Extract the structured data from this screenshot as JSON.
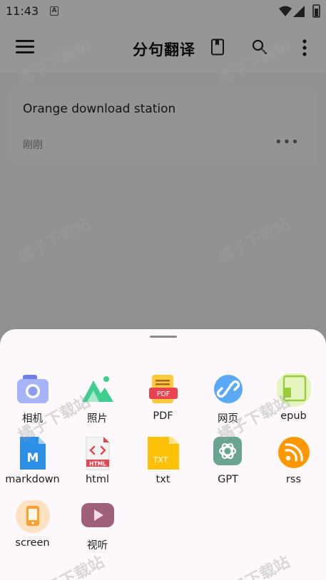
{
  "status_bar": {
    "time": "11:43",
    "notification_letter": "A"
  },
  "app_bar": {
    "title": "分句翻译",
    "icons": [
      "menu-icon",
      "book-icon",
      "search-icon",
      "more-vert-icon"
    ]
  },
  "documents": [
    {
      "title": "Orange download station",
      "time": "刚刚"
    }
  ],
  "import_sheet": {
    "items": [
      {
        "label": "相机",
        "icon": "camera-icon",
        "color": "#8c9cf2"
      },
      {
        "label": "照片",
        "icon": "photo-icon",
        "color": "#3ecf8e"
      },
      {
        "label": "PDF",
        "icon": "pdf-icon",
        "color": "#e8434f",
        "badge": "PDF"
      },
      {
        "label": "网页",
        "icon": "link-icon",
        "color": "#5aa9f5"
      },
      {
        "label": "epub",
        "icon": "epub-icon",
        "color": "#9ccc3c"
      },
      {
        "label": "markdown",
        "icon": "markdown-icon",
        "color": "#2e8fe6",
        "badge": "M"
      },
      {
        "label": "html",
        "icon": "html-icon",
        "color": "#e8434f",
        "badge": "HTML"
      },
      {
        "label": "txt",
        "icon": "txt-icon",
        "color": "#ffc107",
        "badge": "TXT"
      },
      {
        "label": "GPT",
        "icon": "openai-icon",
        "color": "#6aa592"
      },
      {
        "label": "rss",
        "icon": "rss-icon",
        "color": "#ff9800"
      },
      {
        "label": "screen",
        "icon": "screen-icon",
        "color": "#ff9f2f"
      },
      {
        "label": "视听",
        "icon": "video-icon",
        "color": "#a0607a"
      }
    ]
  },
  "watermark": "橘子下载站"
}
